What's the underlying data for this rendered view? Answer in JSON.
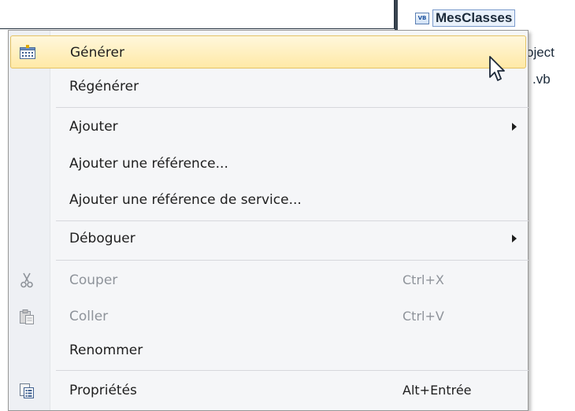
{
  "solution_explorer": {
    "project_icon_text": "VB",
    "project_name": "MesClasses",
    "partial_items": [
      "oject",
      ".vb"
    ]
  },
  "context_menu": {
    "items": [
      {
        "label": "Générer",
        "shortcut": "",
        "icon": "build-icon",
        "submenu": false,
        "enabled": true,
        "highlighted": true
      },
      {
        "label": "Régénérer",
        "shortcut": "",
        "icon": "",
        "submenu": false,
        "enabled": true,
        "highlighted": false
      },
      {
        "label": "Ajouter",
        "shortcut": "",
        "icon": "",
        "submenu": true,
        "enabled": true,
        "highlighted": false
      },
      {
        "label": "Ajouter une référence...",
        "shortcut": "",
        "icon": "",
        "submenu": false,
        "enabled": true,
        "highlighted": false
      },
      {
        "label": "Ajouter une référence de service...",
        "shortcut": "",
        "icon": "",
        "submenu": false,
        "enabled": true,
        "highlighted": false
      },
      {
        "label": "Déboguer",
        "shortcut": "",
        "icon": "",
        "submenu": true,
        "enabled": true,
        "highlighted": false
      },
      {
        "label": "Couper",
        "shortcut": "Ctrl+X",
        "icon": "scissors-icon",
        "submenu": false,
        "enabled": false,
        "highlighted": false
      },
      {
        "label": "Coller",
        "shortcut": "Ctrl+V",
        "icon": "clipboard-icon",
        "submenu": false,
        "enabled": false,
        "highlighted": false
      },
      {
        "label": "Renommer",
        "shortcut": "",
        "icon": "",
        "submenu": false,
        "enabled": true,
        "highlighted": false
      },
      {
        "label": "Propriétés",
        "shortcut": "Alt+Entrée",
        "icon": "properties-icon",
        "submenu": false,
        "enabled": true,
        "highlighted": false
      }
    ]
  },
  "colors": {
    "highlight_top": "#fff7dc",
    "highlight_bottom": "#ffe9a6",
    "highlight_border": "#e5c365",
    "disabled_text": "#8e939a"
  }
}
